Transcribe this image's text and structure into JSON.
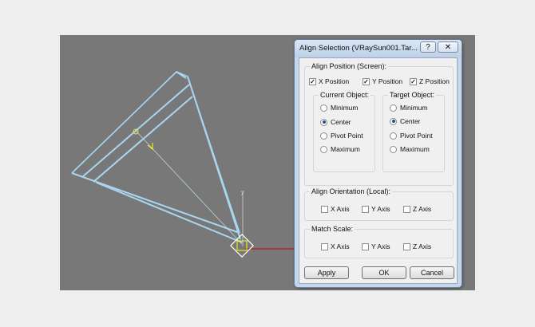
{
  "dialog": {
    "title": "Align Selection (VRaySun001.Tar...",
    "help_label": "?",
    "close_label": "✕"
  },
  "align_position": {
    "label": "Align Position (Screen):",
    "checks": [
      {
        "label": "X Position",
        "checked": true
      },
      {
        "label": "Y Position",
        "checked": true
      },
      {
        "label": "Z Position",
        "checked": true
      }
    ],
    "current_object": {
      "label": "Current Object:",
      "options": [
        "Minimum",
        "Center",
        "Pivot Point",
        "Maximum"
      ],
      "selected": "Center"
    },
    "target_object": {
      "label": "Target Object:",
      "options": [
        "Minimum",
        "Center",
        "Pivot Point",
        "Maximum"
      ],
      "selected": "Center"
    }
  },
  "align_orientation": {
    "label": "Align Orientation (Local):",
    "checks": [
      {
        "label": "X Axis",
        "checked": false
      },
      {
        "label": "Y Axis",
        "checked": false
      },
      {
        "label": "Z Axis",
        "checked": false
      }
    ]
  },
  "match_scale": {
    "label": "Match Scale:",
    "checks": [
      {
        "label": "X Axis",
        "checked": false
      },
      {
        "label": "Y Axis",
        "checked": false
      },
      {
        "label": "Z Axis",
        "checked": false
      }
    ]
  },
  "buttons": {
    "apply": "Apply",
    "ok": "OK",
    "cancel": "Cancel"
  },
  "viewport": {
    "gizmo_axis_label": "y",
    "colors": {
      "background": "#787878",
      "light_object": "#a9d6f0",
      "gizmo": "#ffff00",
      "axis_x": "#cc0000"
    }
  }
}
